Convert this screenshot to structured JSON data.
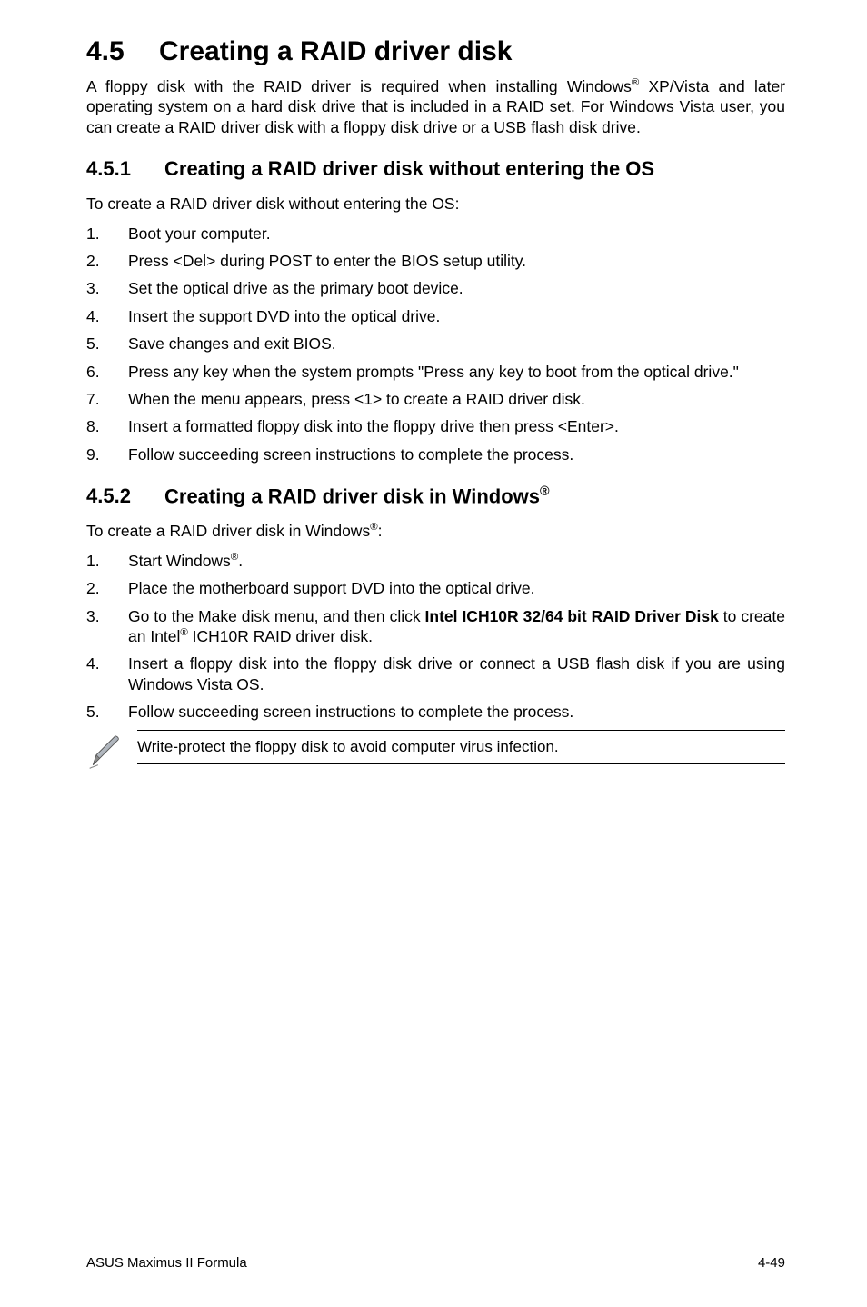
{
  "h1": {
    "num": "4.5",
    "title": "Creating a RAID driver disk"
  },
  "intro": {
    "p1a": "A floppy disk with the RAID driver is required when installing Windows",
    "sup1": "®",
    "p1b": " XP/Vista and later operating system on a hard disk drive that is included in a RAID set. For Windows Vista user, you can create a RAID driver disk with a floppy disk drive or a USB flash disk drive."
  },
  "s451": {
    "num": "4.5.1",
    "title": "Creating a RAID driver disk without entering the OS",
    "lead": "To create a RAID driver disk without entering the OS:",
    "items": [
      {
        "n": "1.",
        "t": "Boot your computer."
      },
      {
        "n": "2.",
        "t": "Press <Del> during POST to enter the BIOS setup utility."
      },
      {
        "n": "3.",
        "t": "Set the optical drive as the primary boot device."
      },
      {
        "n": "4.",
        "t": "Insert the support DVD into the optical drive."
      },
      {
        "n": "5.",
        "t": "Save changes and exit BIOS."
      },
      {
        "n": "6.",
        "t": "Press any key when the system prompts \"Press any key to boot from the optical drive.\""
      },
      {
        "n": "7.",
        "t": "When the menu appears, press <1> to create a RAID driver disk."
      },
      {
        "n": "8.",
        "t": "Insert a formatted floppy disk into the floppy drive then press <Enter>."
      },
      {
        "n": "9.",
        "t": "Follow succeeding screen instructions to complete the process."
      }
    ]
  },
  "s452": {
    "num": "4.5.2",
    "title_a": "Creating a RAID driver disk in Windows",
    "title_sup": "®",
    "lead_a": "To create a RAID driver disk in Windows",
    "lead_sup": "®",
    "lead_b": ":",
    "items": {
      "i1": {
        "n": "1.",
        "a": "Start Windows",
        "sup": "®",
        "b": "."
      },
      "i2": {
        "n": "2.",
        "t": "Place the motherboard support DVD into the optical drive."
      },
      "i3": {
        "n": "3.",
        "a": "Go to the Make disk menu, and then click ",
        "bold": "Intel ICH10R 32/64 bit RAID Driver Disk",
        "b": " to create an Intel",
        "sup": "®",
        "c": " ICH10R RAID driver disk."
      },
      "i4": {
        "n": "4.",
        "t": "Insert a floppy disk into the floppy disk drive or connect a USB flash disk if you are using Windows Vista OS."
      },
      "i5": {
        "n": "5.",
        "t": "Follow succeeding screen instructions to complete the process."
      }
    }
  },
  "note": "Write-protect the floppy disk to avoid computer virus infection.",
  "footer": {
    "left": "ASUS Maximus II Formula",
    "right": "4-49"
  }
}
